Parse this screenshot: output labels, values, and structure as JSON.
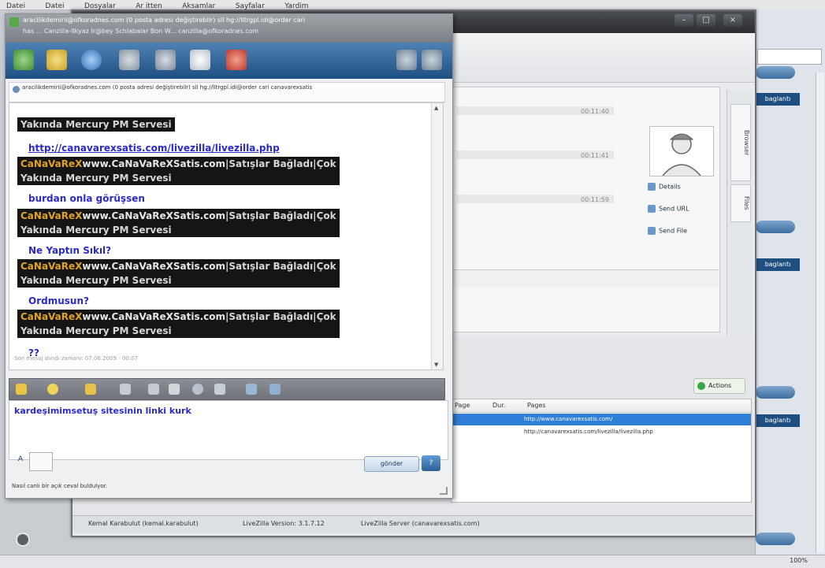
{
  "menubar": {
    "items": [
      "Datei",
      "Datei",
      "Dosyalar",
      "Ar itten",
      "Aksamlar",
      "Sayfalar",
      "Yardim"
    ]
  },
  "background_window": {
    "actions_label": "Actions",
    "visitor_actions": [
      "Details",
      "Send URL",
      "Send File"
    ],
    "side_tabs": [
      "Browser",
      "Files"
    ],
    "chat_times": [
      "00:11:40",
      "00:11:41",
      "00:11:59"
    ],
    "table_headers": [
      "Page",
      "Dur.",
      "Pages"
    ],
    "table_rows": [
      {
        "page": "http://www.canavarexsatis.com/",
        "selected": true
      },
      {
        "page": "http://canavarexsatis.com/livezilla/livezilla.php",
        "selected": false
      }
    ],
    "status": [
      "Kemal Karabulut (kemal.karabulut)",
      "LiveZilla Version: 3.1.7.12",
      "LiveZilla Server (canavarexsatis.com)"
    ]
  },
  "right_panel": {
    "pill_label": "",
    "tag_label": "baglantı"
  },
  "taskbar": {
    "zoom": "100%"
  },
  "chat_window": {
    "title_line1": "aracilikdemirii@ofkoradnes.com (0 posta adresi değiştirebilr) sll hg://lltrgpl.idi@order cari",
    "title_line2": "has ... Canzilla-Ilkyaz Ir@bey Schlabalar Bon W...   canzilla@ofkoradnes.com",
    "header_text": "aracilikdemirii@ofkoradnes.com (0 posta adresi değiştirebilr) sll hg://lltrgpl.idi@order cari canavarexsatis",
    "messages": [
      {
        "type": "banner_tail",
        "text": "Yakında Mercury PM Servesi"
      },
      {
        "type": "user",
        "text": "http://canavarexsatis.com/livezilla/livezilla.php",
        "underline": true
      },
      {
        "type": "banner",
        "nick": "CaNaVaReX",
        "site": "www.CaNaVaReXSatis.com",
        "tail": "|Satışlar Bağladı|Çok",
        "line2": "Yakında Mercury PM Servesi"
      },
      {
        "type": "user",
        "text": "burdan onla görüşsen",
        "underline": false
      },
      {
        "type": "banner",
        "nick": "CaNaVaReX",
        "site": "www.CaNaVaReXSatis.com",
        "tail": "|Satışlar Bağladı|Çok",
        "line2": "Yakında Mercury PM Servesi"
      },
      {
        "type": "user",
        "text": "Ne Yaptın Sıkıl?",
        "underline": false
      },
      {
        "type": "banner",
        "nick": "CaNaVaReX",
        "site": "www.CaNaVaReXSatis.com",
        "tail": "|Satışlar Bağladı|Çok",
        "line2": "Yakında Mercury PM Servesi"
      },
      {
        "type": "user",
        "text": "Ordmusun?",
        "underline": false
      },
      {
        "type": "banner",
        "nick": "CaNaVaReX",
        "site": "www.CaNaVaReXSatis.com",
        "tail": "|Satışlar Bağladı|Çok",
        "line2": "Yakında Mercury PM Servesi"
      },
      {
        "type": "user",
        "text": "??",
        "underline": false
      }
    ],
    "transcript_footer": "Son mesaj alındı zamanı: 07.06.2009 - 00:07",
    "compose_value": "kardeşimimsetuş sitesinin linki kurk",
    "send_label": "gönder",
    "typing_status": "Nasıl canlı bir açık ceval buldulyor."
  },
  "colors": {
    "toolbar": "#2f64a0",
    "nick": "#e0a322",
    "user_text": "#2a2ac8",
    "banner_bg": "#151515"
  }
}
